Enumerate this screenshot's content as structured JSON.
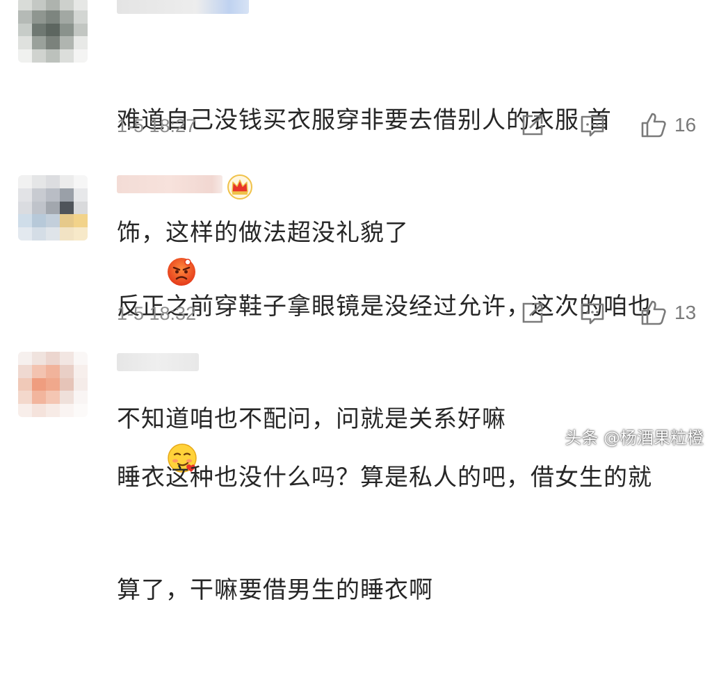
{
  "comments": [
    {
      "text_line1": "难道自己没钱买衣服穿非要去借别人的衣服 首",
      "text_line2": "饰，这样的做法超没礼貌了",
      "emoji": "angry-face-icon",
      "time": "1-5 18:27",
      "likes": "16"
    },
    {
      "text_line1": "反正之前穿鞋子拿眼镜是没经过允许，这次的咱也",
      "text_line2": "不知道咱也不配问，问就是关系好嘛",
      "emoji": "smirk-face-icon",
      "badge": "crown-icon",
      "time": "1-5 18:32",
      "likes": "13"
    },
    {
      "text_line1": "睡衣这种也没什么吗？算是私人的吧，借女生的就",
      "text_line2": "算了，干嘛要借男生的睡衣啊"
    }
  ],
  "watermark": "头条 @杨酒果粒橙",
  "colors": {
    "text": "#262626",
    "meta": "#8c8c8c",
    "icon": "#7a7a7a"
  }
}
